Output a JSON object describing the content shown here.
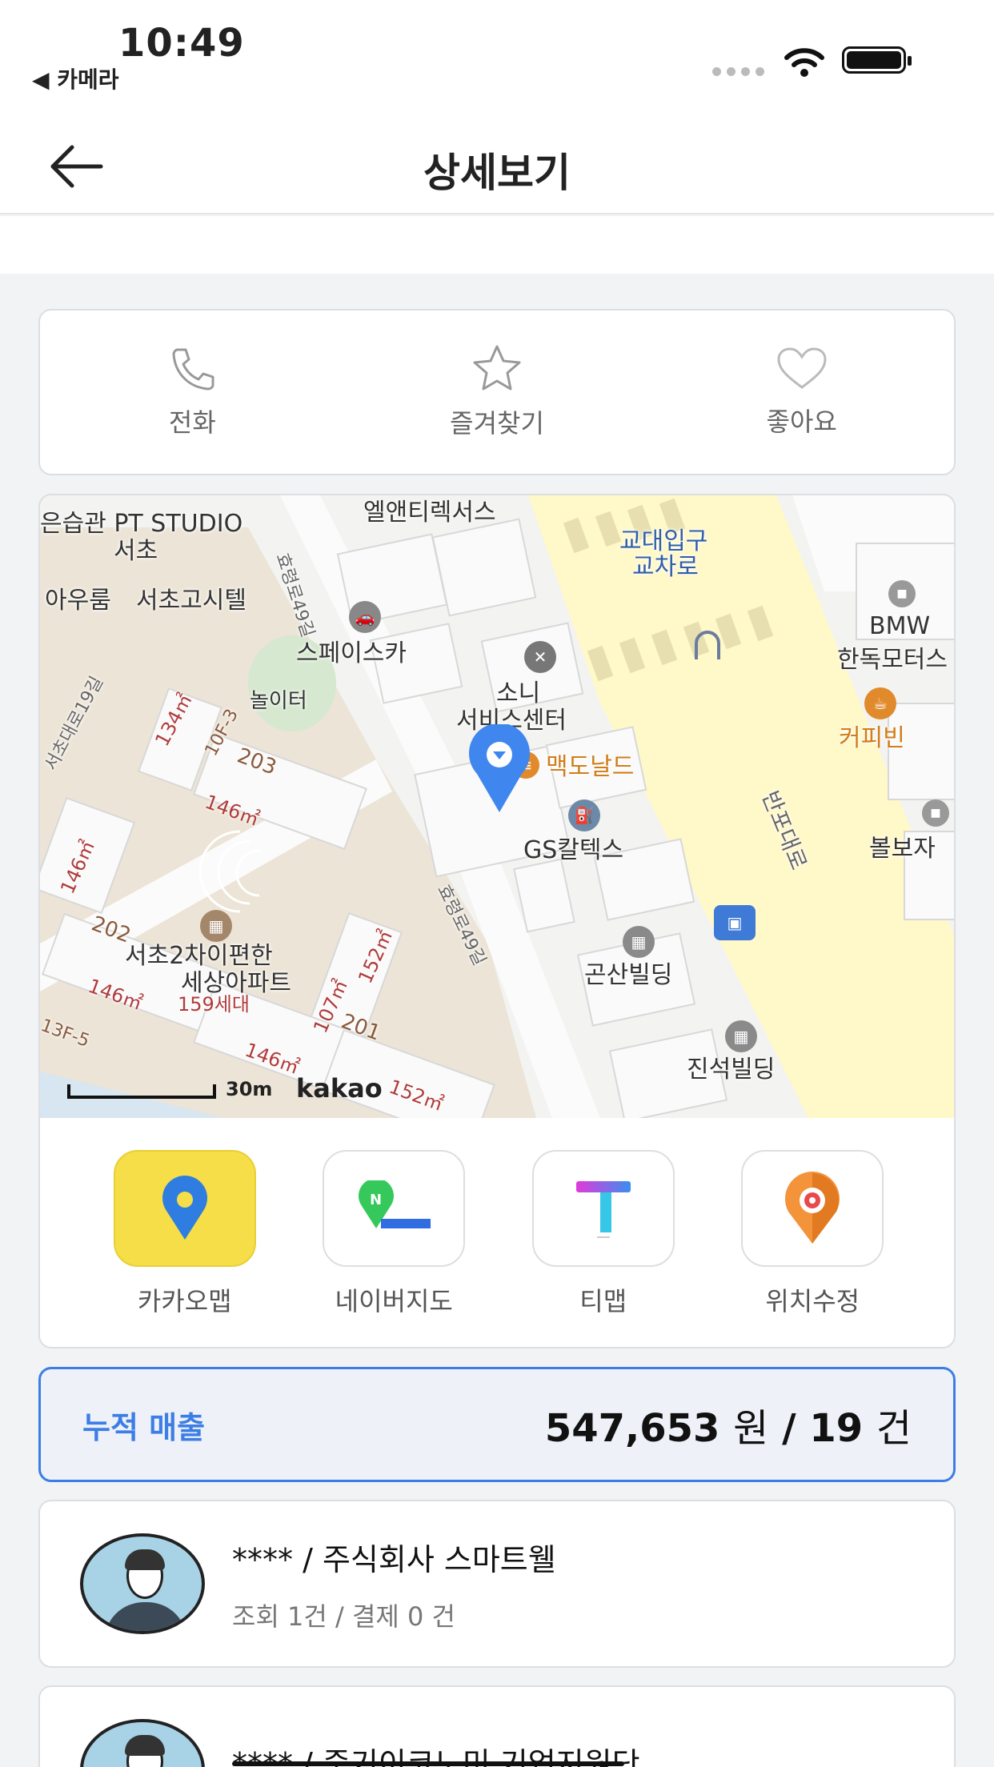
{
  "status_bar": {
    "time": "10:49",
    "back_app": "◀ 카메라"
  },
  "nav": {
    "title": "상세보기"
  },
  "actions": [
    {
      "label": "전화",
      "icon": "phone-icon"
    },
    {
      "label": "즐겨찾기",
      "icon": "star-icon"
    },
    {
      "label": "좋아요",
      "icon": "heart-icon"
    }
  ],
  "map": {
    "labels": {
      "pt_studio": "은습관 PT STUDIO",
      "seocho": "서초",
      "aroom": "아우룸",
      "gositel": "서초고시텔",
      "el_trax": "엘앤티렉서스",
      "gyodae": "교대입구",
      "gyocharo": "교차로",
      "bmw": "BMW",
      "hanok_motor": "한독모터스",
      "spacecar": "스페이스카",
      "playground": "놀이터",
      "sony": "소니",
      "service_center": "서비스센터",
      "coffee_bean": "커피빈",
      "mcdonalds": "맥도날드",
      "gs_caltex": "GS칼텍스",
      "banpo_daero": "반포대로",
      "bolboja": "볼보자",
      "apartment": "서초2차이편한",
      "apartment2": "세상아파트",
      "households": "159세대",
      "gonsan": "곤산빌딩",
      "jinseok": "진석빌딩",
      "road_49": "효령로49길",
      "road_49b": "효령로49길",
      "road_19": "서초대로19길",
      "bld_203": "203",
      "bld_202": "202",
      "bld_201": "201",
      "area_134": "134㎡",
      "area_146a": "146㎡",
      "area_146b": "146㎡",
      "area_146c": "146㎡",
      "area_146d": "146㎡",
      "area_152": "152㎡",
      "area_107": "107㎡",
      "area_152b": "152㎡",
      "floor_10f": "10F-3",
      "floor_13f": "13F-5"
    },
    "scale": "30m",
    "brand": "kakao"
  },
  "apps": [
    {
      "label": "카카오맵",
      "icon": "kakaomap-icon"
    },
    {
      "label": "네이버지도",
      "icon": "navermap-icon"
    },
    {
      "label": "티맵",
      "icon": "tmap-icon"
    },
    {
      "label": "위치수정",
      "icon": "location-edit-icon"
    }
  ],
  "sales": {
    "label": "누적 매출",
    "amount": "547,653",
    "amount_unit": "원",
    "separator": "/",
    "count": "19",
    "count_unit": "건"
  },
  "people": [
    {
      "name": "**** / 주식회사 스마트웰",
      "stat": "조회 1건 / 결제 0 건"
    },
    {
      "name": "**** / 중기이코노미 기업지원단",
      "stat": ""
    }
  ],
  "colors": {
    "accent": "#3d7ee6",
    "kakao_yellow": "#f5de47",
    "road_yellow": "#fff8c8"
  }
}
